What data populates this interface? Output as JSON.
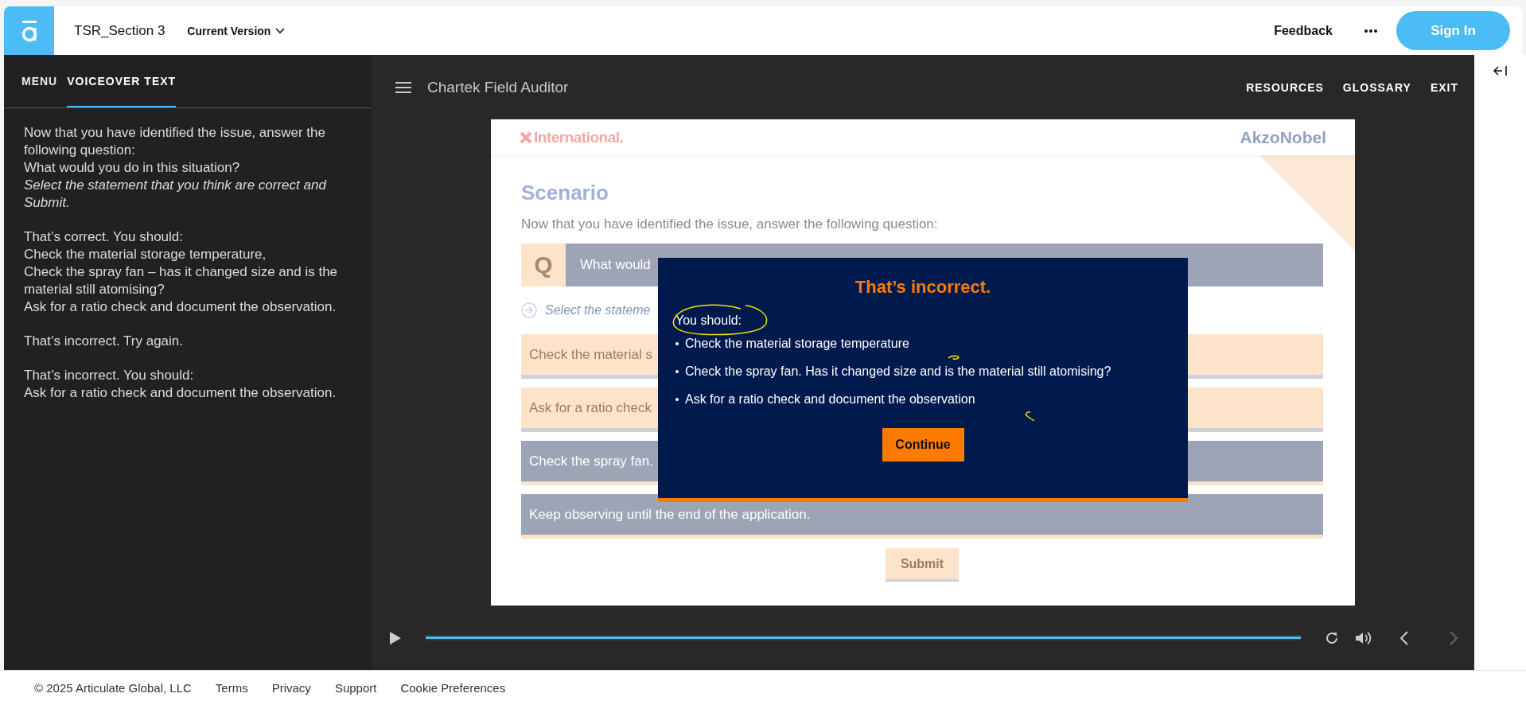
{
  "header": {
    "title": "TSR_Section 3",
    "version": "Current Version",
    "feedback": "Feedback",
    "sign_in": "Sign In"
  },
  "sidebar": {
    "tabs": [
      {
        "label": "MENU",
        "selected": false
      },
      {
        "label": "VOICEOVER TEXT",
        "selected": true
      }
    ],
    "blocks": [
      {
        "lines": [
          {
            "text": "Now that you have identified the issue, answer the following question:",
            "kind": "normal"
          },
          {
            "text": "What would you do in this situation?",
            "kind": "normal"
          },
          {
            "text": "Select the statement that you think are correct and Submit.",
            "kind": "italic"
          }
        ]
      },
      {
        "lines": [
          {
            "text": "That’s correct. You should:",
            "kind": "normal"
          },
          {
            "text": "Check the material storage temperature,",
            "kind": "normal"
          },
          {
            "text": "Check the spray fan – has it changed size and is the material still atomising?",
            "kind": "normal"
          },
          {
            "text": "Ask for a ratio check and document the observation.",
            "kind": "normal"
          }
        ]
      },
      {
        "lines": [
          {
            "text": "That’s incorrect. Try again.",
            "kind": "normal"
          }
        ]
      },
      {
        "lines": [
          {
            "text": "That’s incorrect. You should:",
            "kind": "normal"
          },
          {
            "text": "Ask for a ratio check and document the observation.",
            "kind": "normal"
          }
        ]
      }
    ]
  },
  "player": {
    "title": "Chartek Field Auditor",
    "nav": [
      "RESOURCES",
      "GLOSSARY",
      "EXIT"
    ],
    "slide": {
      "brand_left": "International.",
      "brand_right": "AkzoNobel",
      "heading": "Scenario",
      "intro": "Now that you have identified the issue, answer the following question:",
      "question_mark": "Q",
      "question": "What would",
      "hint": "Select the stateme",
      "options": [
        {
          "text": "Check the material s",
          "selected": true
        },
        {
          "text": "Ask for a ratio check",
          "selected": true
        },
        {
          "text": "Check the spray fan.",
          "selected": false
        },
        {
          "text": "Keep observing until the end of the application.",
          "selected": false
        }
      ],
      "submit": "Submit"
    },
    "feedback": {
      "title": "That’s incorrect.",
      "lead": "You should:",
      "bullets": [
        "Check the material storage temperature",
        "Check the spray fan. Has it changed size and is the material still atomising?",
        "Ask for a ratio check and document the observation"
      ],
      "button": "Continue"
    },
    "progress": {
      "level": 1
    }
  },
  "footer": {
    "copyright": "© 2025 Articulate Global, LLC",
    "links": [
      "Terms",
      "Privacy",
      "Support",
      "Cookie Preferences"
    ]
  }
}
